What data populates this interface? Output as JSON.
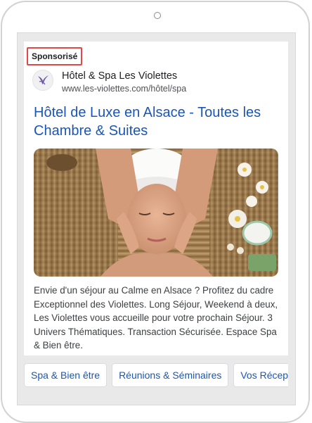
{
  "ad": {
    "sponsored_label": "Sponsorisé",
    "site_name": "Hôtel & Spa Les Violettes",
    "display_url": "www.les-violettes.com/hôtel/spa",
    "headline": "Hôtel de Luxe en Alsace - Toutes les Chambre & Suites",
    "description": "Envie d'un séjour au Calme en Alsace ? Profitez du cadre Exceptionnel des Violettes. Long Séjour, Weekend à deux, Les Violettes vous accueille pour votre prochain Séjour. 3 Univers Thématiques. Transaction Sécurisée. Espace Spa & Bien être."
  },
  "sitelinks": [
    {
      "label": "Spa & Bien être"
    },
    {
      "label": "Réunions & Séminaires"
    },
    {
      "label": "Vos Récep"
    }
  ],
  "colors": {
    "link_blue": "#1a56b8",
    "highlight_red": "#e0484a"
  }
}
